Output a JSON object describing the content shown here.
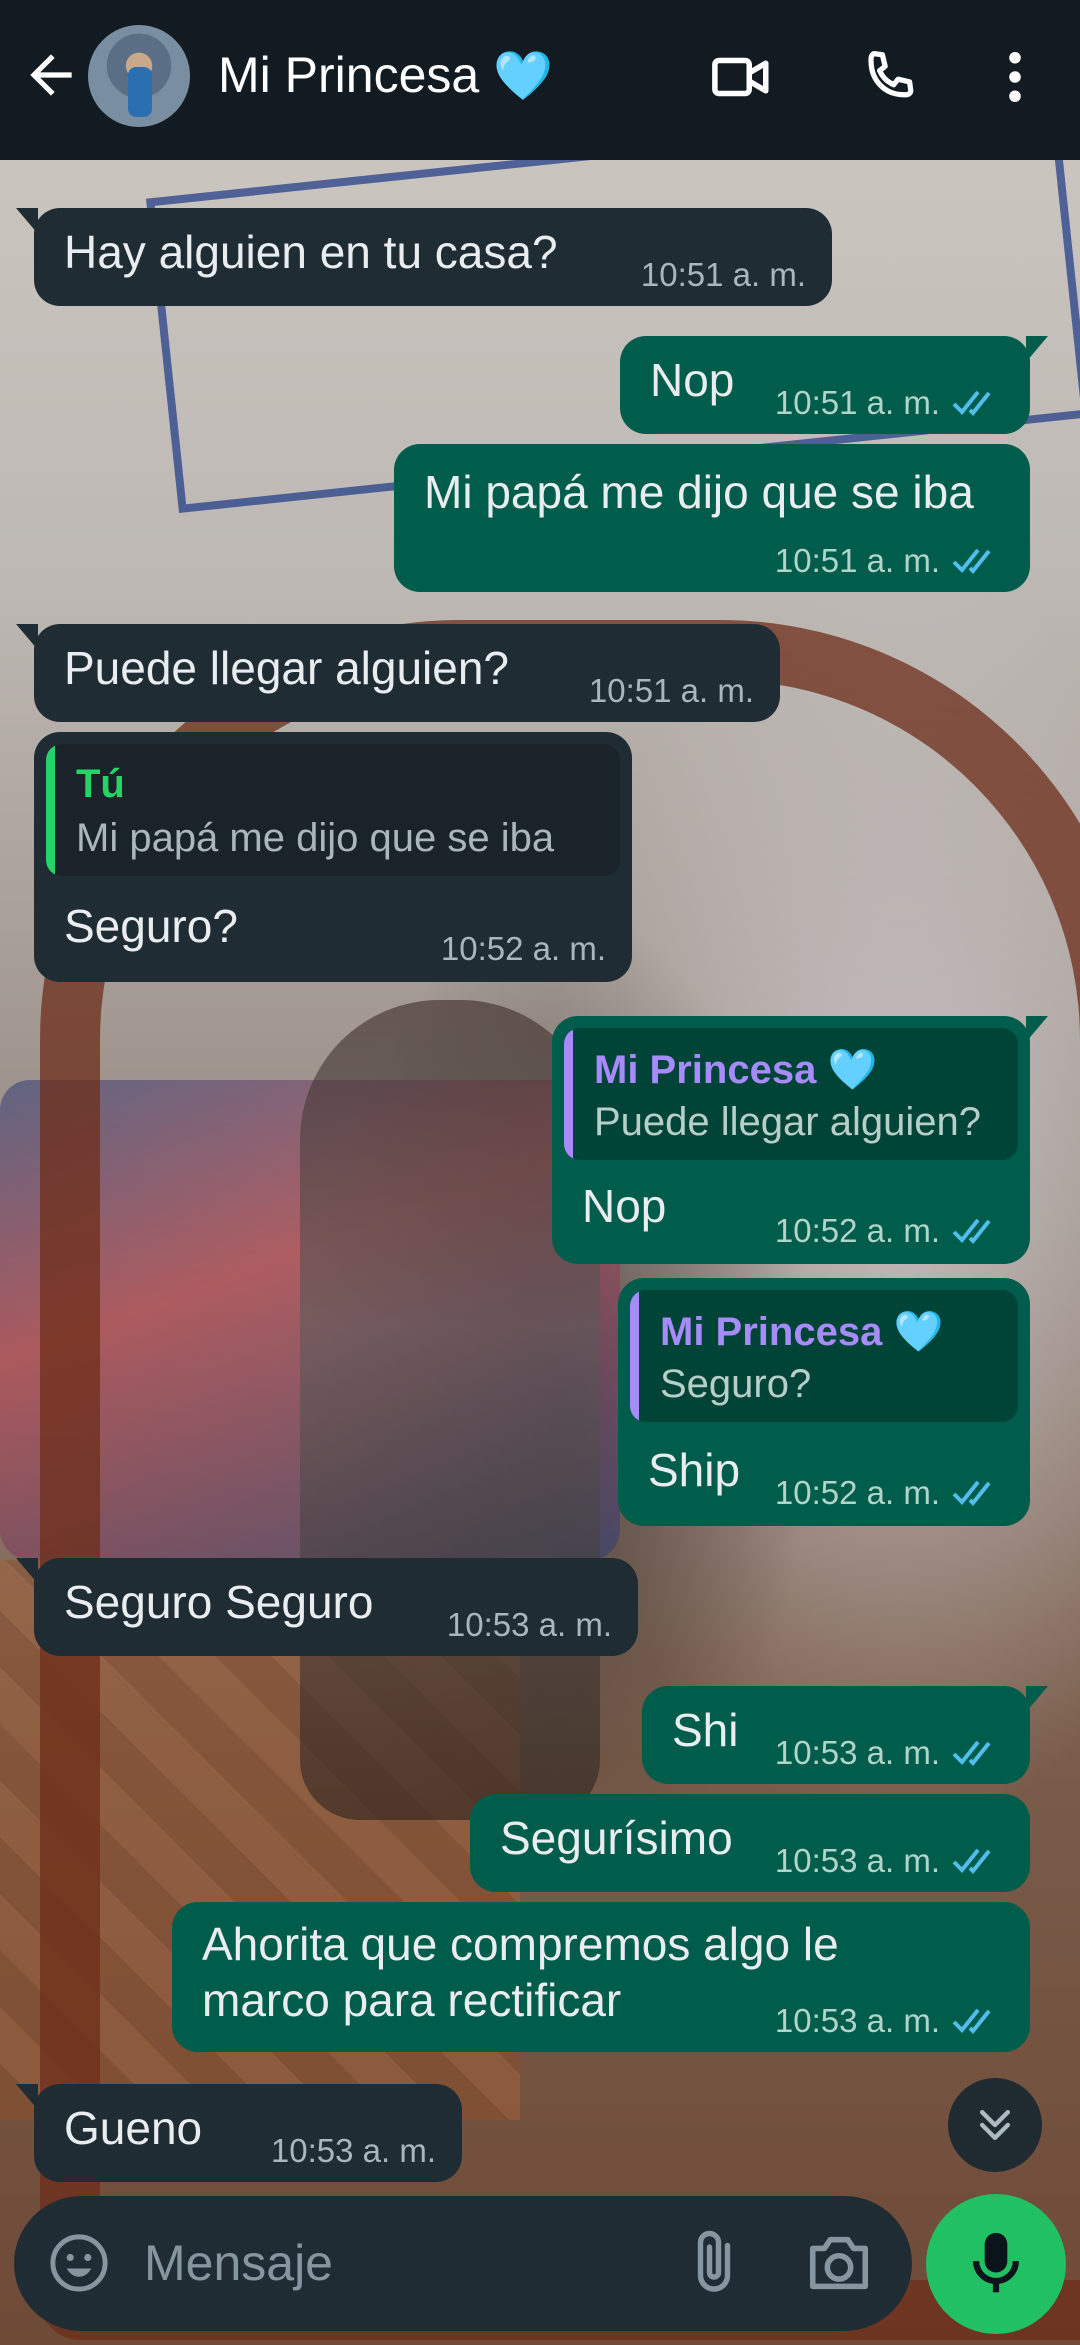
{
  "header": {
    "contact_name": "Mi Princesa",
    "contact_emoji": "🩵",
    "icons": [
      "back-arrow-icon",
      "video-call-icon",
      "voice-call-icon",
      "more-options-icon"
    ]
  },
  "messages": [
    {
      "dir": "in",
      "text": "Hay alguien en tu casa?",
      "time": "10:51 a. m."
    },
    {
      "dir": "out",
      "text": "Nop",
      "time": "10:51 a. m.",
      "status": "read"
    },
    {
      "dir": "out",
      "text": "Mi papá me dijo que se iba",
      "time": "10:51 a. m.",
      "status": "read"
    },
    {
      "dir": "in",
      "text": "Puede llegar alguien?",
      "time": "10:51 a. m."
    },
    {
      "dir": "in",
      "quote_author": "Tú",
      "quote_text": "Mi papá me dijo que se iba",
      "text": "Seguro?",
      "time": "10:52 a. m."
    },
    {
      "dir": "out",
      "quote_author": "Mi Princesa 🩵",
      "quote_text": "Puede llegar alguien?",
      "text": "Nop",
      "time": "10:52 a. m.",
      "status": "read"
    },
    {
      "dir": "out",
      "quote_author": "Mi Princesa 🩵",
      "quote_text": "Seguro?",
      "text": "Ship",
      "time": "10:52 a. m.",
      "status": "read"
    },
    {
      "dir": "in",
      "text": "Seguro Seguro",
      "time": "10:53 a. m."
    },
    {
      "dir": "out",
      "text": "Shi",
      "time": "10:53 a. m.",
      "status": "read"
    },
    {
      "dir": "out",
      "text": "Segurísimo",
      "time": "10:53 a. m.",
      "status": "read"
    },
    {
      "dir": "out",
      "text_line1": "Ahorita que compremos algo le",
      "text_line2": "marco para rectificar",
      "time": "10:53 a. m.",
      "status": "read"
    },
    {
      "dir": "in",
      "text": "Gueno",
      "time": "10:53 a. m."
    }
  ],
  "input": {
    "placeholder": "Mensaje"
  },
  "colors": {
    "header_bg": "#121b22",
    "incoming_bubble": "#202c33",
    "outgoing_bubble": "#005c4b",
    "read_ticks": "#53bdeb",
    "mic_button": "#21c063",
    "quote_self": "#25d366",
    "quote_contact": "#a78bfa"
  }
}
